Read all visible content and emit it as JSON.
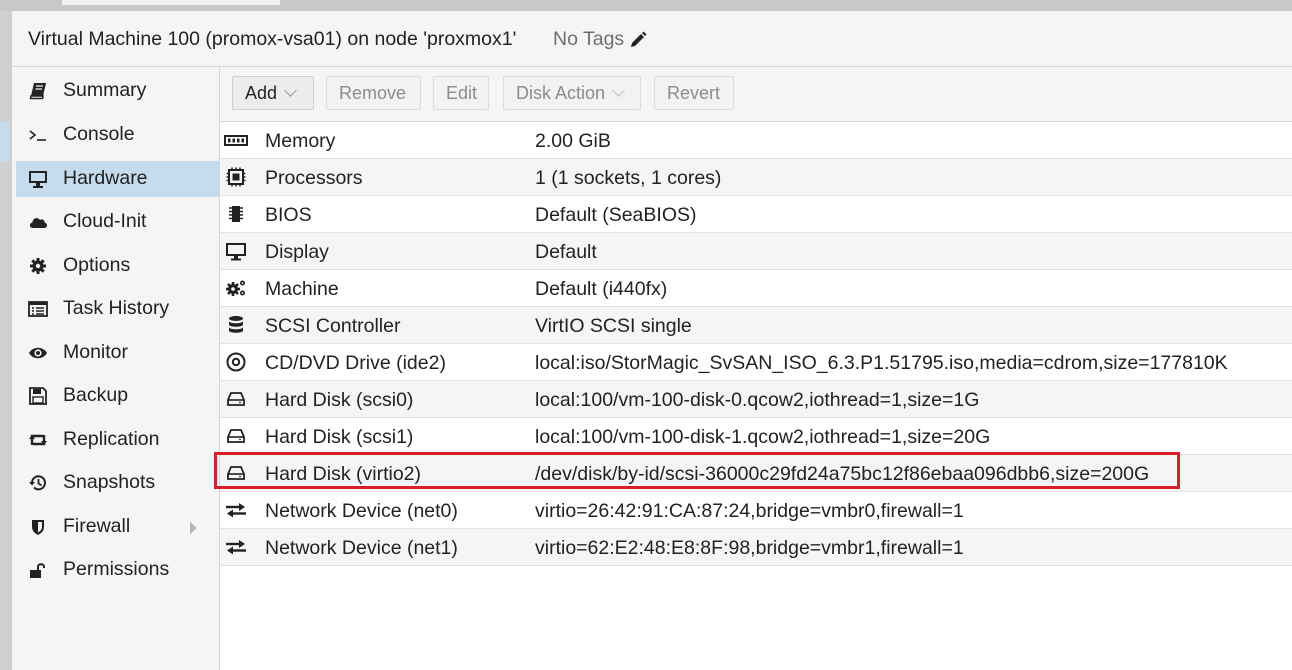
{
  "window": {
    "title": "Virtual Machine 100 (promox-vsa01) on node 'proxmox1'",
    "tags_label": "No Tags",
    "tags_icon": "pencil-icon"
  },
  "sidebar": {
    "items": [
      {
        "label": "Summary",
        "icon": "book-icon"
      },
      {
        "label": "Console",
        "icon": "terminal-icon"
      },
      {
        "label": "Hardware",
        "icon": "desktop-icon",
        "active": true
      },
      {
        "label": "Cloud-Init",
        "icon": "cloud-icon"
      },
      {
        "label": "Options",
        "icon": "gear-icon"
      },
      {
        "label": "Task History",
        "icon": "list-icon"
      },
      {
        "label": "Monitor",
        "icon": "eye-icon"
      },
      {
        "label": "Backup",
        "icon": "floppy-icon"
      },
      {
        "label": "Replication",
        "icon": "retweet-icon"
      },
      {
        "label": "Snapshots",
        "icon": "history-icon"
      },
      {
        "label": "Firewall",
        "icon": "shield-icon",
        "has_submenu": true
      },
      {
        "label": "Permissions",
        "icon": "unlock-icon"
      }
    ]
  },
  "toolbar": {
    "add_label": "Add",
    "remove_label": "Remove",
    "edit_label": "Edit",
    "disk_action_label": "Disk Action",
    "revert_label": "Revert"
  },
  "hardware": {
    "rows": [
      {
        "name": "Memory",
        "value": "2.00 GiB",
        "icon": "memory-icon"
      },
      {
        "name": "Processors",
        "value": "1 (1 sockets, 1 cores)",
        "icon": "cpu-icon"
      },
      {
        "name": "BIOS",
        "value": "Default (SeaBIOS)",
        "icon": "microchip-icon"
      },
      {
        "name": "Display",
        "value": "Default",
        "icon": "desktop-icon"
      },
      {
        "name": "Machine",
        "value": "Default (i440fx)",
        "icon": "cogs-icon"
      },
      {
        "name": "SCSI Controller",
        "value": "VirtIO SCSI single",
        "icon": "database-icon"
      },
      {
        "name": "CD/DVD Drive (ide2)",
        "value": "local:iso/StorMagic_SvSAN_ISO_6.3.P1.51795.iso,media=cdrom,size=177810K",
        "icon": "cdrom-icon"
      },
      {
        "name": "Hard Disk (scsi0)",
        "value": "local:100/vm-100-disk-0.qcow2,iothread=1,size=1G",
        "icon": "hdd-icon"
      },
      {
        "name": "Hard Disk (scsi1)",
        "value": "local:100/vm-100-disk-1.qcow2,iothread=1,size=20G",
        "icon": "hdd-icon"
      },
      {
        "name": "Hard Disk (virtio2)",
        "value": "/dev/disk/by-id/scsi-36000c29fd24a75bc12f86ebaa096dbb6,size=200G",
        "icon": "hdd-icon"
      },
      {
        "name": "Network Device (net0)",
        "value": "virtio=26:42:91:CA:87:24,bridge=vmbr0,firewall=1",
        "icon": "exchange-icon"
      },
      {
        "name": "Network Device (net1)",
        "value": "virtio=62:E2:48:E8:8F:98,bridge=vmbr1,firewall=1",
        "icon": "exchange-icon"
      }
    ]
  },
  "colors": {
    "active_nav": "#c5dcef",
    "annotation_box": "#d9202a"
  }
}
